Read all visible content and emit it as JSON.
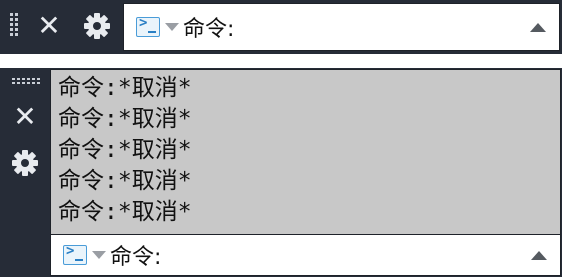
{
  "top_bar": {
    "close_icon": "close-icon",
    "settings_icon": "gear-icon",
    "command_input": {
      "prompt_icon": "command-prompt-icon",
      "label": "命令:",
      "value": ""
    }
  },
  "history_panel": {
    "lines": [
      "命令:*取消*",
      "命令:*取消*",
      "命令:*取消*",
      "命令:*取消*",
      "命令:*取消*"
    ],
    "command_input": {
      "prompt_icon": "command-prompt-icon",
      "label": "命令:",
      "value": ""
    }
  },
  "colors": {
    "chrome_background": "#262c37",
    "history_background": "#c8c8c8",
    "input_background": "#ffffff",
    "prompt_icon_accent": "#2a7fc4"
  }
}
